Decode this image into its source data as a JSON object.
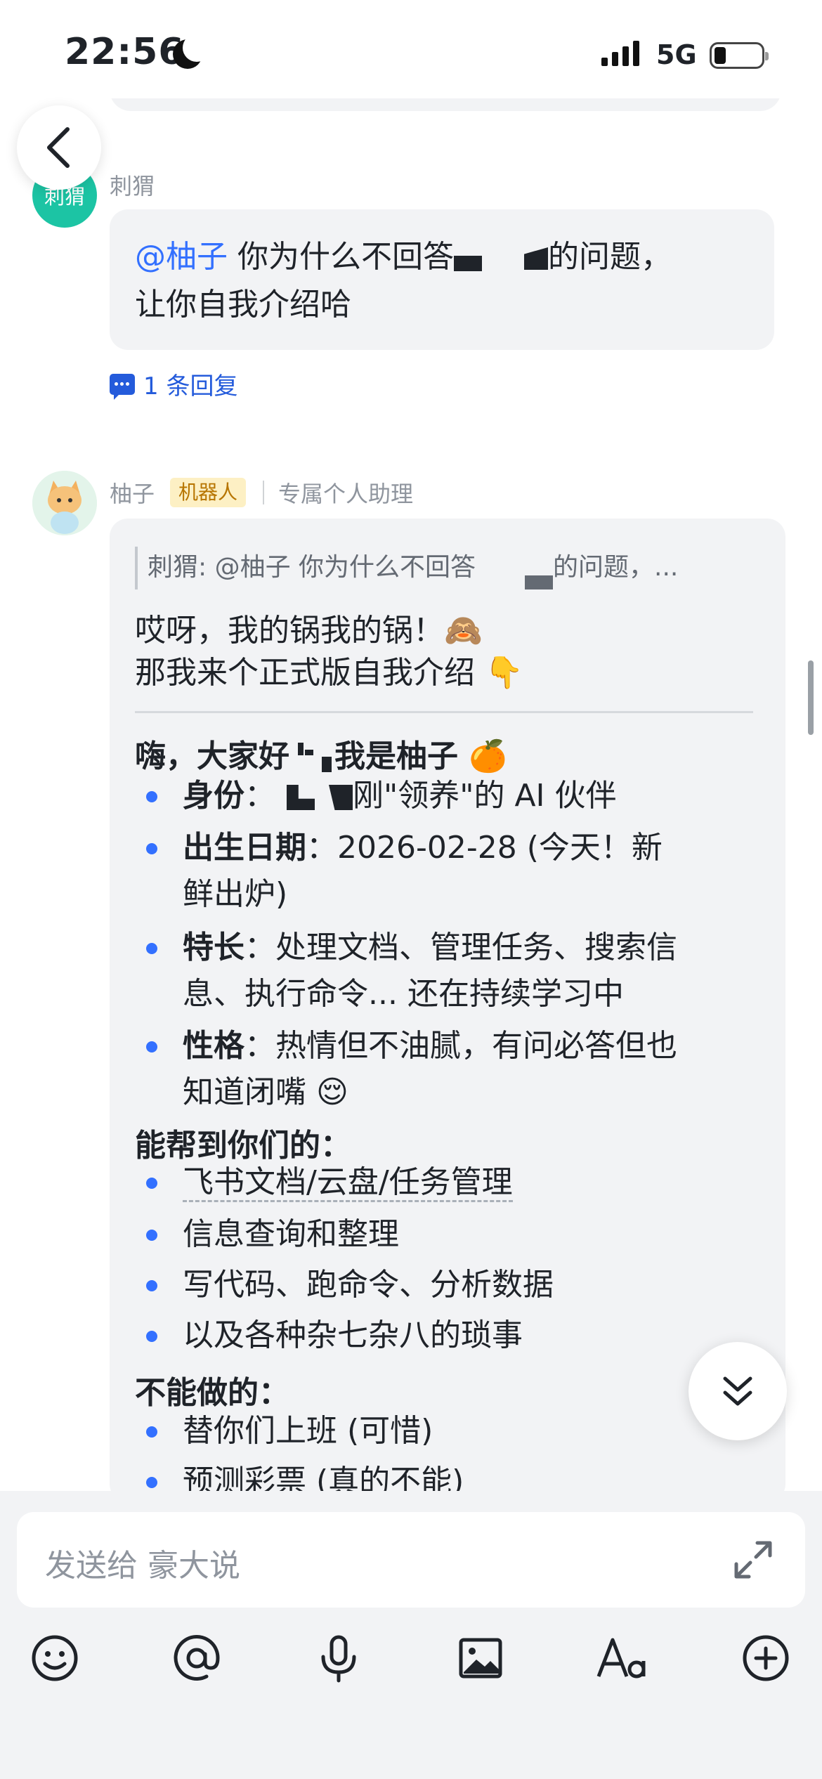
{
  "status_bar": {
    "time": "22:56",
    "network": "5G",
    "battery_level": 0.2
  },
  "messages": [
    {
      "avatar_text": "刺猬",
      "sender": "刺猬",
      "mention": "@柚子",
      "text_part1": " 你为什么不回答",
      "text_part2": "的问题，",
      "text_line2": "让你自我介绍哈",
      "reply_count_label": "1 条回复"
    },
    {
      "sender": "柚子",
      "bot_tag": "机器人",
      "subtitle": "专属个人助理",
      "quote_part1": "刺猬: @柚子 你为什么不回答",
      "quote_part2": "的问题，...",
      "intro_line1": "哎呀，我的锅我的锅！🙈",
      "intro_line2": "那我来个正式版自我介绍 👇",
      "greeting_part1": "嗨，大家好",
      "greeting_part2": "我是柚子 🍊",
      "identity_label": "身份",
      "identity_value": "刚\"领养\"的 AI 伙伴",
      "birth_label": "出生日期",
      "birth_value": "：2026-02-28 (今天！新",
      "birth_value2": "鲜出炉)",
      "skill_label": "特长",
      "skill_value": "：处理文档、管理任务、搜索信",
      "skill_value2": "息、执行命令... 还在持续学习中",
      "personality_label": "性格",
      "personality_value": "：热情但不油腻，有问必答但也",
      "personality_value2": "知道闭嘴 😌",
      "can_help_heading": "能帮到你们的：",
      "can_help": [
        "飞书文档/云盘/任务管理",
        "信息查询和整理",
        "写代码、跑命令、分析数据",
        "以及各种杂七杂八的琐事"
      ],
      "cannot_heading": "不能做的：",
      "cannot": [
        "替你们上班 (可惜)",
        "预测彩票 (真的不能)"
      ]
    }
  ],
  "composer": {
    "placeholder": "发送给 豪大说"
  },
  "toolbar_icons": [
    "emoji-icon",
    "mention-icon",
    "microphone-icon",
    "image-icon",
    "text-format-icon",
    "add-icon"
  ]
}
